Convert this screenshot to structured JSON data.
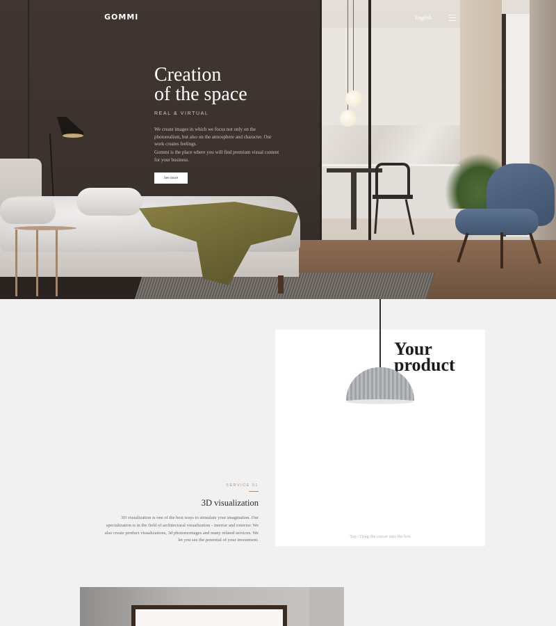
{
  "header": {
    "logo": "GOMMI",
    "language": "English",
    "menu_icon": "hamburger-icon"
  },
  "hero": {
    "title_line1": "Creation",
    "title_line2": "of the space",
    "subtitle": "REAL & VIRTUAL",
    "paragraph1": "We create images in which we focus not only on the photorealism, but also on the atmosphere and character. Our work creates feelings.",
    "paragraph2": "Gommi is the place where you will find premium visual content for your business.",
    "button_label": "See more"
  },
  "product_card": {
    "title_line1": "Your",
    "title_line2": "product",
    "hint": "Tap / Drag the cursor into the box"
  },
  "service": {
    "number": "SERVICE 01",
    "title": "3D visualization",
    "description": "3D visualization is one of the best ways to stimulate your imagination. Our specialization is in the field of architectural visualization - interior and exterior. We also create product visualizations, 3d photomontages and many related services. We let you see the potential of your investment."
  },
  "colors": {
    "accent": "#a98f73",
    "background": "#f2f1f1",
    "hero_dark": "#3b322e"
  }
}
